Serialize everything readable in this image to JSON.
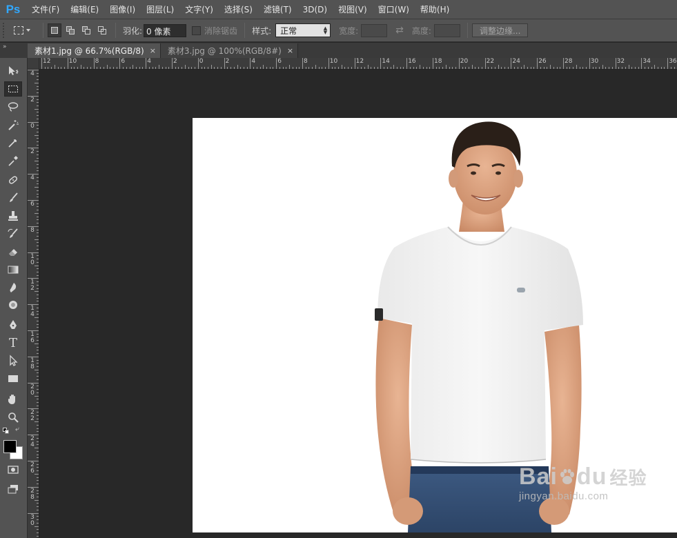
{
  "app": {
    "logo": "Ps"
  },
  "menu": [
    "文件(F)",
    "编辑(E)",
    "图像(I)",
    "图层(L)",
    "文字(Y)",
    "选择(S)",
    "滤镜(T)",
    "3D(D)",
    "视图(V)",
    "窗口(W)",
    "帮助(H)"
  ],
  "options": {
    "feather_label": "羽化:",
    "feather_value": "0 像素",
    "antialias_label": "消除锯齿",
    "style_label": "样式:",
    "style_value": "正常",
    "width_label": "宽度:",
    "height_label": "高度:",
    "refine_edge_label": "调整边缘..."
  },
  "tabs": [
    {
      "label": "素材1.jpg @ 66.7%(RGB/8)",
      "active": true,
      "close": "×"
    },
    {
      "label": "素材3.jpg @ 100%(RGB/8#)",
      "active": false,
      "close": "×"
    }
  ],
  "hruler_labels": [
    "12",
    "10",
    "8",
    "6",
    "4",
    "2",
    "0",
    "2",
    "4",
    "6",
    "8",
    "10",
    "12",
    "14",
    "16",
    "18",
    "20",
    "22",
    "24",
    "26",
    "28",
    "30",
    "32",
    "34",
    "36"
  ],
  "vruler_labels": [
    "4",
    "2",
    "0",
    "2",
    "4",
    "6",
    "8",
    "10",
    "12",
    "14",
    "16",
    "18",
    "20",
    "22",
    "24",
    "26",
    "28",
    "30"
  ],
  "watermark": {
    "brand_a": "Bai",
    "brand_b": "du",
    "brand_cn": "经验",
    "url": "jingyan.baidu.com"
  },
  "colors": {
    "accent": "#31a8ff",
    "foreground": "#000000",
    "background": "#ffffff"
  },
  "tools": [
    "move-tool",
    "rect-marquee-tool",
    "lasso-tool",
    "magic-wand-tool",
    "crop-tool",
    "eyedropper-tool",
    "healing-brush-tool",
    "brush-tool",
    "clone-stamp-tool",
    "history-brush-tool",
    "eraser-tool",
    "gradient-tool",
    "blur-tool",
    "dodge-tool",
    "pen-tool",
    "type-tool",
    "path-selection-tool",
    "rectangle-tool",
    "hand-tool",
    "zoom-tool"
  ]
}
